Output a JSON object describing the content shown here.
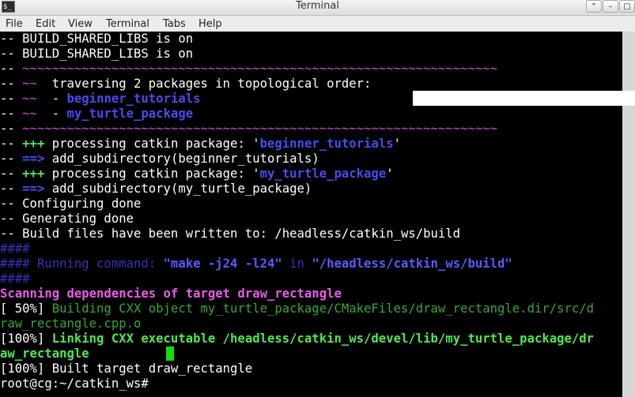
{
  "window": {
    "title": "Terminal",
    "icon": "terminal-icon",
    "buttons": [
      "⌃",
      "–",
      "□"
    ]
  },
  "menu": [
    "File",
    "Edit",
    "View",
    "Terminal",
    "Tabs",
    "Help"
  ],
  "colors": {
    "background": "#000000",
    "text": "#ffffff",
    "magenta": "#c94bd0",
    "blue": "#4a4af0",
    "green": "#4fe84f",
    "cursor": "#11dd11"
  },
  "terminal": {
    "lines": [
      [
        {
          "t": "-- BUILD_SHARED_LIBS is on",
          "c": ""
        }
      ],
      [
        {
          "t": "-- BUILD_SHARED_LIBS is on",
          "c": ""
        }
      ],
      [
        {
          "t": "-- ",
          "c": ""
        },
        {
          "t": "~~~~~~~~~~~~~~~~~~~~~~~~~~~~~~~~~~~~~~~~~~~~~~~~~~~~~~~~~~~~~~~~",
          "c": "mag"
        }
      ],
      [
        {
          "t": "-- ",
          "c": ""
        },
        {
          "t": "~~",
          "c": "mag"
        },
        {
          "t": "  traversing 2 packages in topological order:",
          "c": ""
        }
      ],
      [
        {
          "t": "-- ",
          "c": ""
        },
        {
          "t": "~~",
          "c": "mag"
        },
        {
          "t": "  - ",
          "c": ""
        },
        {
          "t": "beginner_tutorials",
          "c": "blue"
        }
      ],
      [
        {
          "t": "-- ",
          "c": ""
        },
        {
          "t": "~~",
          "c": "mag"
        },
        {
          "t": "  - ",
          "c": ""
        },
        {
          "t": "my_turtle_package",
          "c": "blue"
        }
      ],
      [
        {
          "t": "-- ",
          "c": ""
        },
        {
          "t": "~~~~~~~~~~~~~~~~~~~~~~~~~~~~~~~~~~~~~~~~~~~~~~~~~~~~~~~~~~~~~~~~",
          "c": "mag"
        }
      ],
      [
        {
          "t": "-- ",
          "c": ""
        },
        {
          "t": "+++",
          "c": "green"
        },
        {
          "t": " processing catkin package: '",
          "c": ""
        },
        {
          "t": "beginner_tutorials",
          "c": "blue"
        },
        {
          "t": "'",
          "c": ""
        }
      ],
      [
        {
          "t": "-- ",
          "c": ""
        },
        {
          "t": "==>",
          "c": "blue"
        },
        {
          "t": " add_subdirectory(beginner_tutorials)",
          "c": ""
        }
      ],
      [
        {
          "t": "-- ",
          "c": ""
        },
        {
          "t": "+++",
          "c": "green"
        },
        {
          "t": " processing catkin package: '",
          "c": ""
        },
        {
          "t": "my_turtle_package",
          "c": "blue"
        },
        {
          "t": "'",
          "c": ""
        }
      ],
      [
        {
          "t": "-- ",
          "c": ""
        },
        {
          "t": "==>",
          "c": "blue"
        },
        {
          "t": " add_subdirectory(my_turtle_package)",
          "c": ""
        }
      ],
      [
        {
          "t": "-- Configuring done",
          "c": ""
        }
      ],
      [
        {
          "t": "-- Generating done",
          "c": ""
        }
      ],
      [
        {
          "t": "-- Build files have been written to: /headless/catkin_ws/build",
          "c": ""
        }
      ],
      [
        {
          "t": "####",
          "c": "dimblue"
        }
      ],
      [
        {
          "t": "#### Running command: ",
          "c": "dimblue"
        },
        {
          "t": "\"make -j24 -l24\"",
          "c": "brightblue"
        },
        {
          "t": " in ",
          "c": "dimblue"
        },
        {
          "t": "\"/headless/catkin_ws/build\"",
          "c": "brightblue"
        }
      ],
      [
        {
          "t": "####",
          "c": "dimblue"
        }
      ],
      [
        {
          "t": "Scanning dependencies of target draw_rectangle",
          "c": "pinkbold"
        }
      ],
      [
        {
          "t": "[ 50%] ",
          "c": ""
        },
        {
          "t": "Building CXX object my_turtle_package/CMakeFiles/draw_rectangle.dir/src/d",
          "c": "dkgreen"
        }
      ],
      [
        {
          "t": "raw_rectangle.cpp.o",
          "c": "dkgreen"
        }
      ],
      [
        {
          "t": "[100%] ",
          "c": ""
        },
        {
          "t": "Linking CXX executable /headless/catkin_ws/devel/lib/my_turtle_package/dr",
          "c": "green"
        }
      ],
      [
        {
          "t": "aw_rectangle",
          "c": "green"
        }
      ],
      [
        {
          "t": "[100%] Built target draw_rectangle",
          "c": ""
        }
      ],
      [
        {
          "t": "root@cg:~/catkin_ws# ",
          "c": ""
        }
      ]
    ]
  }
}
